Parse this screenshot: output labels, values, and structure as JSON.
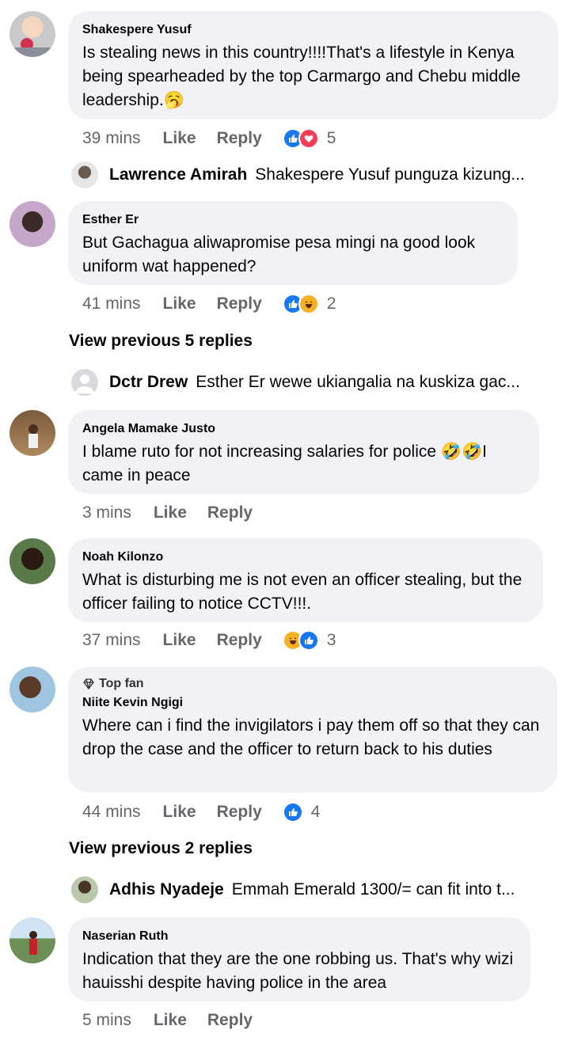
{
  "comments": [
    {
      "author": "Shakespere Yusuf",
      "text": "Is stealing news in this country!!!!That's a lifestyle in Kenya being spearheaded by the top Carmargo and Chebu middle leadership.🥱",
      "time": "39 mins",
      "like_label": "Like",
      "reply_label": "Reply",
      "reactions": [
        "like",
        "love"
      ],
      "reaction_count": "5"
    },
    {
      "author": "Esther Er",
      "text": "But Gachagua aliwapromise pesa mingi na good look uniform wat happened?",
      "time": "41 mins",
      "like_label": "Like",
      "reply_label": "Reply",
      "reactions": [
        "like",
        "haha"
      ],
      "reaction_count": "2"
    },
    {
      "author": "Angela Mamake Justo",
      "text": "I blame ruto for not increasing salaries for police 🤣🤣I came in peace",
      "time": "3 mins",
      "like_label": "Like",
      "reply_label": "Reply"
    },
    {
      "author": "Noah Kilonzo",
      "text": "What is disturbing me is not even an officer stealing, but the officer failing to notice CCTV!!!.",
      "time": "37 mins",
      "like_label": "Like",
      "reply_label": "Reply",
      "reactions": [
        "haha",
        "like"
      ],
      "reaction_count": "3"
    },
    {
      "badge": "Top fan",
      "author": "Niite Kevin Ngigi",
      "text": "Where can i find the invigilators i pay them off so that they can drop the case and the officer to return back to his duties",
      "time": "44 mins",
      "like_label": "Like",
      "reply_label": "Reply",
      "reactions": [
        "like"
      ],
      "reaction_count": "4"
    },
    {
      "author": "Naserian Ruth",
      "text": "Indication that they are the one robbing us.  That's why wizi hauisshi despite having police in the area",
      "time": "5 mins",
      "like_label": "Like",
      "reply_label": "Reply"
    }
  ],
  "replies": [
    {
      "author": "Lawrence Amirah",
      "text": "Shakespere Yusuf punguza kizung..."
    },
    {
      "author": "Dctr Drew",
      "text": "Esther Er wewe ukiangalia na kuskiza gac..."
    },
    {
      "author": "Adhis Nyadeje",
      "text": "Emmah Emerald 1300/=  can fit into t..."
    }
  ],
  "view_previous": [
    "View previous 5 replies",
    "View previous 2 replies"
  ],
  "colors": {
    "bubble": "#f0f2f5",
    "meta": "#65676b",
    "like": "#1877f2",
    "love": "#f33e58",
    "haha": "#f7b125"
  }
}
